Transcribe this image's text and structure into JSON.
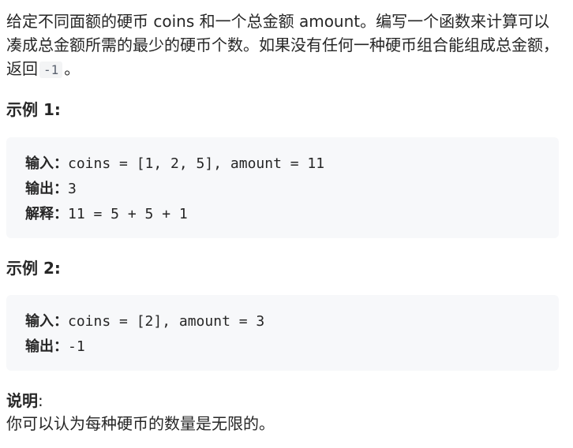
{
  "intro": {
    "text_before": "给定不同面额的硬币 coins 和一个总金额 amount。编写一个函数来计算可以凑成总金额所需的最少的硬币个数。如果没有任何一种硬币组合能组成总金额，返回",
    "code": "-1",
    "text_after": "。"
  },
  "example1": {
    "heading": "示例 1:",
    "lines": [
      {
        "key": "输入：",
        "value": "coins = [1, 2, 5], amount = 11"
      },
      {
        "key": "输出：",
        "value": "3"
      },
      {
        "key": "解释：",
        "value": "11 = 5 + 5 + 1"
      }
    ]
  },
  "example2": {
    "heading": "示例 2:",
    "lines": [
      {
        "key": "输入：",
        "value": "coins = [2], amount = 3"
      },
      {
        "key": "输出：",
        "value": "-1"
      }
    ]
  },
  "note": {
    "title": "说明",
    "colon": ":",
    "text": "你可以认为每种硬币的数量是无限的。"
  }
}
